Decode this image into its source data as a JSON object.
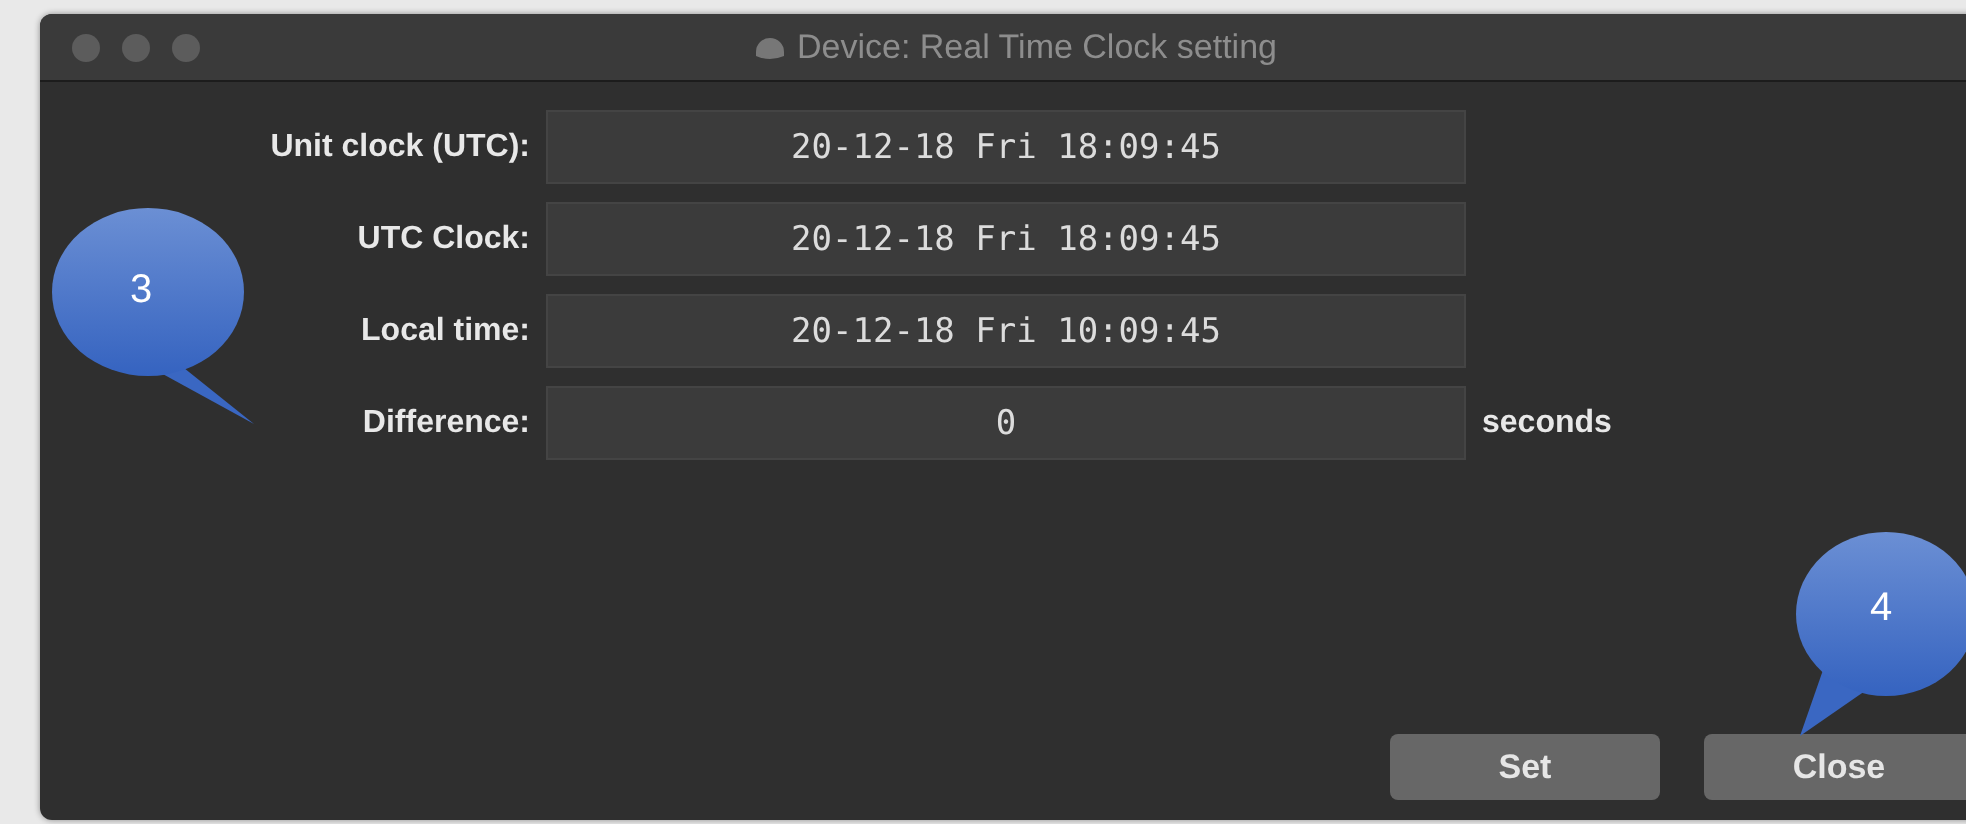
{
  "window": {
    "title": "Device: Real Time Clock setting"
  },
  "rows": [
    {
      "label": "Unit clock (UTC):",
      "value": "20-12-18 Fri 18:09:45"
    },
    {
      "label": "UTC Clock:",
      "value": "20-12-18 Fri 18:09:45"
    },
    {
      "label": "Local time:",
      "value": "20-12-18 Fri 10:09:45"
    },
    {
      "label": "Difference:",
      "value": "0",
      "unit": "seconds"
    }
  ],
  "buttons": [
    "Set",
    "Close"
  ],
  "callouts": [
    {
      "label": "3"
    },
    {
      "label": "4"
    }
  ]
}
